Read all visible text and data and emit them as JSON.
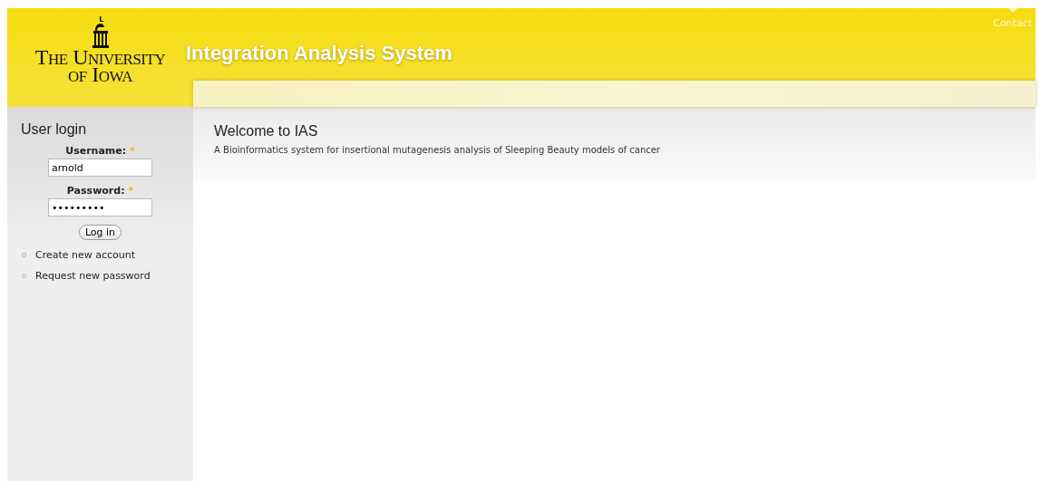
{
  "header": {
    "logo_lines": [
      "The University",
      "of Iowa"
    ],
    "site_title": "Integration Analysis System",
    "nav": [
      {
        "label": "Contact",
        "selected": true
      }
    ]
  },
  "sidebar": {
    "title": "User login",
    "fields": [
      {
        "label": "Username:",
        "required_mark": "*",
        "value": "arnold"
      },
      {
        "label": "Password:",
        "required_mark": "*",
        "value": "•••••••••"
      }
    ],
    "button": "Log in",
    "links": [
      "Create new account",
      "Request new password"
    ]
  },
  "main": {
    "title": "Welcome to IAS",
    "description": "A Bioinformatics system for insertional mutagenesis analysis of Sleeping Beauty models of cancer"
  }
}
